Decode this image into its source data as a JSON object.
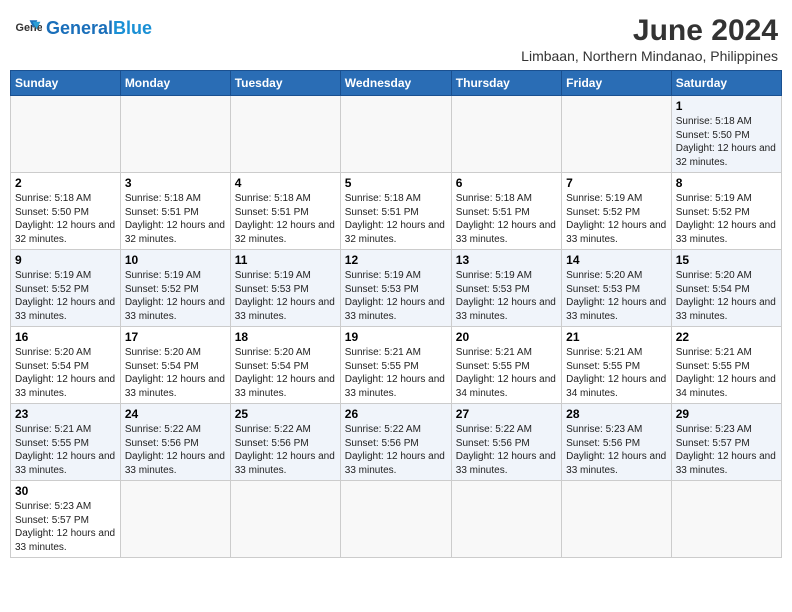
{
  "header": {
    "logo_general": "General",
    "logo_blue": "Blue",
    "month_year": "June 2024",
    "location": "Limbaan, Northern Mindanao, Philippines"
  },
  "weekdays": [
    "Sunday",
    "Monday",
    "Tuesday",
    "Wednesday",
    "Thursday",
    "Friday",
    "Saturday"
  ],
  "weeks": [
    [
      {
        "day": "",
        "info": ""
      },
      {
        "day": "",
        "info": ""
      },
      {
        "day": "",
        "info": ""
      },
      {
        "day": "",
        "info": ""
      },
      {
        "day": "",
        "info": ""
      },
      {
        "day": "",
        "info": ""
      },
      {
        "day": "1",
        "info": "Sunrise: 5:18 AM\nSunset: 5:50 PM\nDaylight: 12 hours and 32 minutes."
      }
    ],
    [
      {
        "day": "2",
        "info": "Sunrise: 5:18 AM\nSunset: 5:50 PM\nDaylight: 12 hours and 32 minutes."
      },
      {
        "day": "3",
        "info": "Sunrise: 5:18 AM\nSunset: 5:51 PM\nDaylight: 12 hours and 32 minutes."
      },
      {
        "day": "4",
        "info": "Sunrise: 5:18 AM\nSunset: 5:51 PM\nDaylight: 12 hours and 32 minutes."
      },
      {
        "day": "5",
        "info": "Sunrise: 5:18 AM\nSunset: 5:51 PM\nDaylight: 12 hours and 32 minutes."
      },
      {
        "day": "6",
        "info": "Sunrise: 5:18 AM\nSunset: 5:51 PM\nDaylight: 12 hours and 33 minutes."
      },
      {
        "day": "7",
        "info": "Sunrise: 5:19 AM\nSunset: 5:52 PM\nDaylight: 12 hours and 33 minutes."
      },
      {
        "day": "8",
        "info": "Sunrise: 5:19 AM\nSunset: 5:52 PM\nDaylight: 12 hours and 33 minutes."
      }
    ],
    [
      {
        "day": "9",
        "info": "Sunrise: 5:19 AM\nSunset: 5:52 PM\nDaylight: 12 hours and 33 minutes."
      },
      {
        "day": "10",
        "info": "Sunrise: 5:19 AM\nSunset: 5:52 PM\nDaylight: 12 hours and 33 minutes."
      },
      {
        "day": "11",
        "info": "Sunrise: 5:19 AM\nSunset: 5:53 PM\nDaylight: 12 hours and 33 minutes."
      },
      {
        "day": "12",
        "info": "Sunrise: 5:19 AM\nSunset: 5:53 PM\nDaylight: 12 hours and 33 minutes."
      },
      {
        "day": "13",
        "info": "Sunrise: 5:19 AM\nSunset: 5:53 PM\nDaylight: 12 hours and 33 minutes."
      },
      {
        "day": "14",
        "info": "Sunrise: 5:20 AM\nSunset: 5:53 PM\nDaylight: 12 hours and 33 minutes."
      },
      {
        "day": "15",
        "info": "Sunrise: 5:20 AM\nSunset: 5:54 PM\nDaylight: 12 hours and 33 minutes."
      }
    ],
    [
      {
        "day": "16",
        "info": "Sunrise: 5:20 AM\nSunset: 5:54 PM\nDaylight: 12 hours and 33 minutes."
      },
      {
        "day": "17",
        "info": "Sunrise: 5:20 AM\nSunset: 5:54 PM\nDaylight: 12 hours and 33 minutes."
      },
      {
        "day": "18",
        "info": "Sunrise: 5:20 AM\nSunset: 5:54 PM\nDaylight: 12 hours and 33 minutes."
      },
      {
        "day": "19",
        "info": "Sunrise: 5:21 AM\nSunset: 5:55 PM\nDaylight: 12 hours and 33 minutes."
      },
      {
        "day": "20",
        "info": "Sunrise: 5:21 AM\nSunset: 5:55 PM\nDaylight: 12 hours and 34 minutes."
      },
      {
        "day": "21",
        "info": "Sunrise: 5:21 AM\nSunset: 5:55 PM\nDaylight: 12 hours and 34 minutes."
      },
      {
        "day": "22",
        "info": "Sunrise: 5:21 AM\nSunset: 5:55 PM\nDaylight: 12 hours and 34 minutes."
      }
    ],
    [
      {
        "day": "23",
        "info": "Sunrise: 5:21 AM\nSunset: 5:55 PM\nDaylight: 12 hours and 33 minutes."
      },
      {
        "day": "24",
        "info": "Sunrise: 5:22 AM\nSunset: 5:56 PM\nDaylight: 12 hours and 33 minutes."
      },
      {
        "day": "25",
        "info": "Sunrise: 5:22 AM\nSunset: 5:56 PM\nDaylight: 12 hours and 33 minutes."
      },
      {
        "day": "26",
        "info": "Sunrise: 5:22 AM\nSunset: 5:56 PM\nDaylight: 12 hours and 33 minutes."
      },
      {
        "day": "27",
        "info": "Sunrise: 5:22 AM\nSunset: 5:56 PM\nDaylight: 12 hours and 33 minutes."
      },
      {
        "day": "28",
        "info": "Sunrise: 5:23 AM\nSunset: 5:56 PM\nDaylight: 12 hours and 33 minutes."
      },
      {
        "day": "29",
        "info": "Sunrise: 5:23 AM\nSunset: 5:57 PM\nDaylight: 12 hours and 33 minutes."
      }
    ],
    [
      {
        "day": "30",
        "info": "Sunrise: 5:23 AM\nSunset: 5:57 PM\nDaylight: 12 hours and 33 minutes."
      },
      {
        "day": "",
        "info": ""
      },
      {
        "day": "",
        "info": ""
      },
      {
        "day": "",
        "info": ""
      },
      {
        "day": "",
        "info": ""
      },
      {
        "day": "",
        "info": ""
      },
      {
        "day": "",
        "info": ""
      }
    ]
  ]
}
